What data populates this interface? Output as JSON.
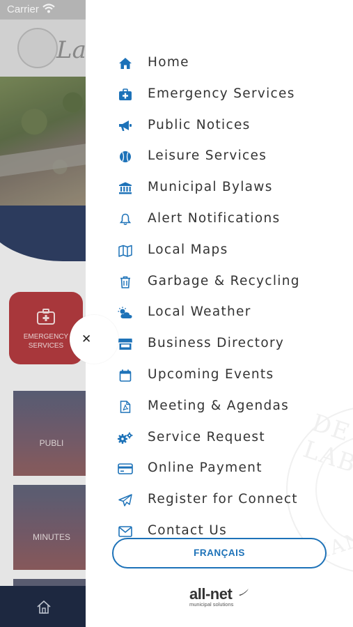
{
  "status_bar": {
    "carrier": "Carrier"
  },
  "background": {
    "emergency_tile_label": "EMERGENCY SERVICES",
    "tiles": [
      {
        "label": "PUBLI"
      },
      {
        "label": "MINUTES"
      }
    ]
  },
  "menu": {
    "items": [
      {
        "label": "Home",
        "icon": "home-icon"
      },
      {
        "label": "Emergency Services",
        "icon": "medical-kit-icon"
      },
      {
        "label": "Public Notices",
        "icon": "megaphone-icon"
      },
      {
        "label": "Leisure Services",
        "icon": "baseball-icon"
      },
      {
        "label": "Municipal Bylaws",
        "icon": "bank-icon"
      },
      {
        "label": "Alert Notifications",
        "icon": "bell-icon"
      },
      {
        "label": "Local Maps",
        "icon": "map-icon"
      },
      {
        "label": "Garbage & Recycling",
        "icon": "trash-icon"
      },
      {
        "label": "Local Weather",
        "icon": "weather-icon"
      },
      {
        "label": "Business Directory",
        "icon": "store-icon"
      },
      {
        "label": "Upcoming Events",
        "icon": "calendar-icon"
      },
      {
        "label": "Meeting & Agendas",
        "icon": "pdf-file-icon"
      },
      {
        "label": "Service Request",
        "icon": "gears-icon"
      },
      {
        "label": "Online Payment",
        "icon": "credit-card-icon"
      },
      {
        "label": "Register for Connect",
        "icon": "paper-plane-icon"
      },
      {
        "label": "Contact Us",
        "icon": "envelope-icon"
      }
    ],
    "language_button": "FRANÇAIS",
    "brand_name": "all-net",
    "brand_tagline": "municipal solutions",
    "watermark_top": "DE LAB",
    "watermark_bottom": "MANITOBA"
  },
  "colors": {
    "accent": "#1d72b8",
    "tile_red": "#b13a3f",
    "navy": "#1f2b44"
  }
}
